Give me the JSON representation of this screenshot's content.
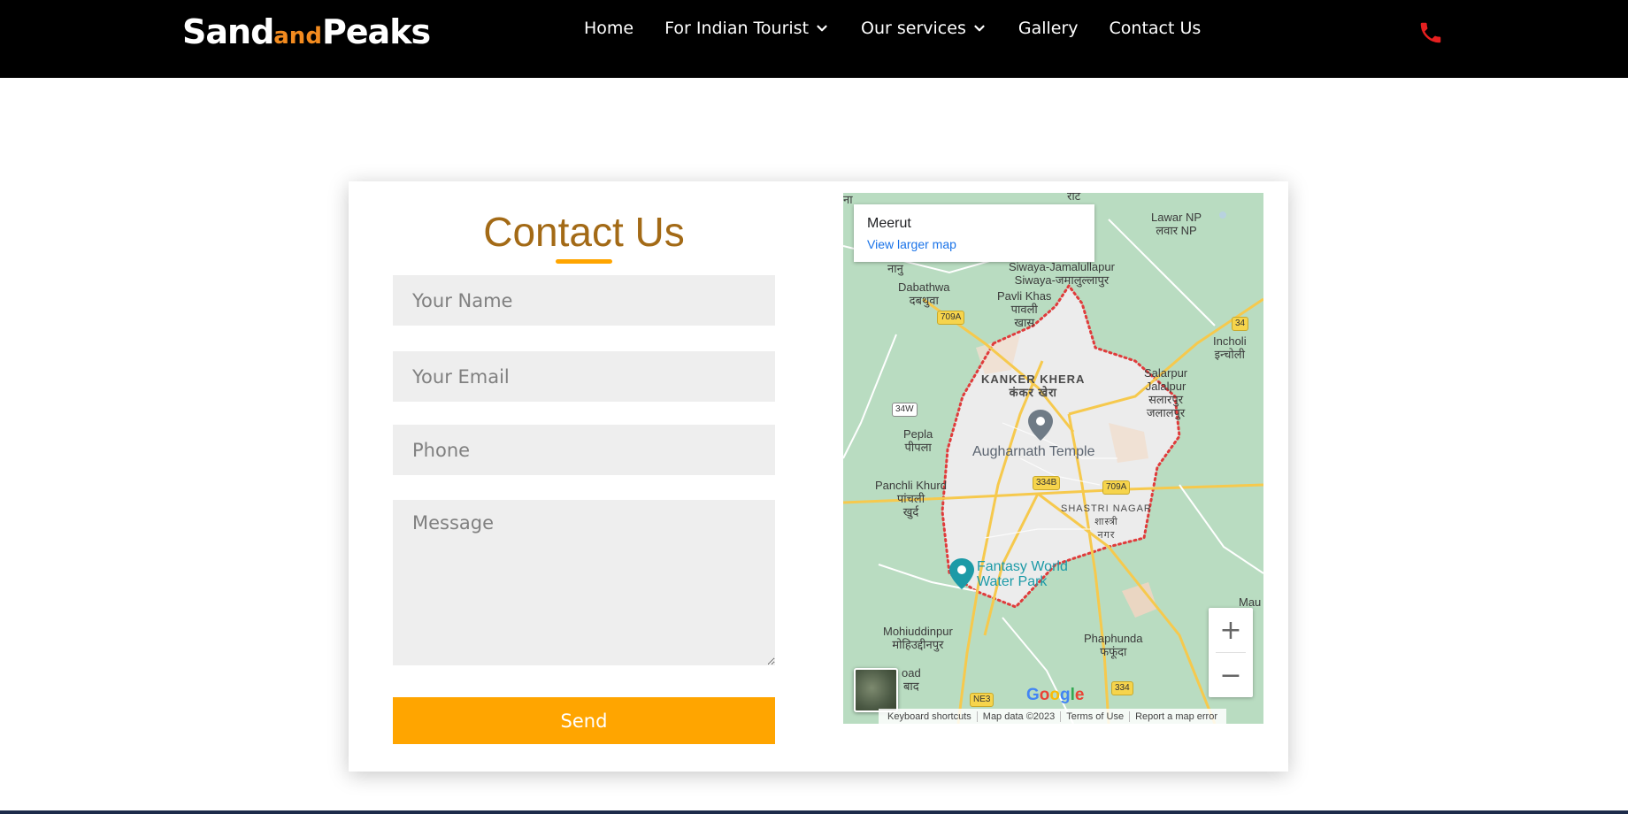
{
  "brand": {
    "part1": "Sand",
    "part2": "and",
    "part3": "Peaks"
  },
  "nav": {
    "items": [
      {
        "label": "Home",
        "has_dropdown": false
      },
      {
        "label": "For Indian Tourist",
        "has_dropdown": true
      },
      {
        "label": "Our services",
        "has_dropdown": true
      },
      {
        "label": "Gallery",
        "has_dropdown": false
      },
      {
        "label": "Contact Us",
        "has_dropdown": false
      }
    ],
    "phone_icon": "phone-icon"
  },
  "form": {
    "title": "Contact Us",
    "name_placeholder": "Your Name",
    "email_placeholder": "Your Email",
    "phone_placeholder": "Phone",
    "message_placeholder": "Message",
    "send_label": "Send"
  },
  "map": {
    "place_title": "Meerut",
    "view_larger": "View larger map",
    "zoom_in": "+",
    "zoom_out": "−",
    "attribution": {
      "keyboard": "Keyboard shortcuts",
      "data": "Map data ©2023",
      "terms": "Terms of Use",
      "report": "Report a map error"
    },
    "labels": {
      "lawar_en": "Lawar NP",
      "lawar_hi": "लवार NP",
      "nanu": "नानु",
      "dabathwa_en": "Dabathwa",
      "dabathwa_hi": "दबथुवा",
      "siwaya_en": "Siwaya-Jamalullapur",
      "siwaya_hi": "Siwaya-जमालुल्लापुर",
      "pavli_en": "Pavli Khas",
      "pavli_hi1": "पावली",
      "pavli_hi2": "खास",
      "incholi_en": "Incholi",
      "incholi_hi": "इन्चोली",
      "kanker_en": "KANKER KHERA",
      "kanker_hi": "कंकर खेरा",
      "salarpur_en1": "Salarpur",
      "salarpur_en2": "Jalalpur",
      "salarpur_hi1": "सलारपुर",
      "salarpur_hi2": "जलालपुर",
      "pepla_en": "Pepla",
      "pepla_hi": "पीपला",
      "temple": "Augharnath Temple",
      "panchli_en": "Panchli Khurd",
      "panchli_hi1": "पांचली",
      "panchli_hi2": "खुर्द",
      "shastri_en": "SHASTRI NAGAR",
      "shastri_hi1": "शास्त्री",
      "shastri_hi2": "नगर",
      "fantasy1": "Fantasy World",
      "fantasy2": "Water Park",
      "mohiuddin_en": "Mohiuddinpur",
      "mohiuddin_hi": "मोहिउद्दीनपुर",
      "phaphunda_en": "Phaphunda",
      "phaphunda_hi": "फफूंदा",
      "road_en": "oad",
      "road_hi": "बाद",
      "mau": "Mau",
      "top_edge": "रीट",
      "left_edge": "ना"
    },
    "shields": {
      "s709a_1": "709A",
      "s34": "34",
      "s34w": "34W",
      "s334b": "334B",
      "s709a_2": "709A",
      "sne3": "NE3",
      "s334": "334"
    }
  },
  "colors": {
    "nav_bg": "#000000",
    "accent_orange": "#ffa500",
    "title_brown": "#a36a16",
    "logo_and": "#f38b1f",
    "phone_red": "#e62020",
    "field_bg": "#eeeeee"
  }
}
